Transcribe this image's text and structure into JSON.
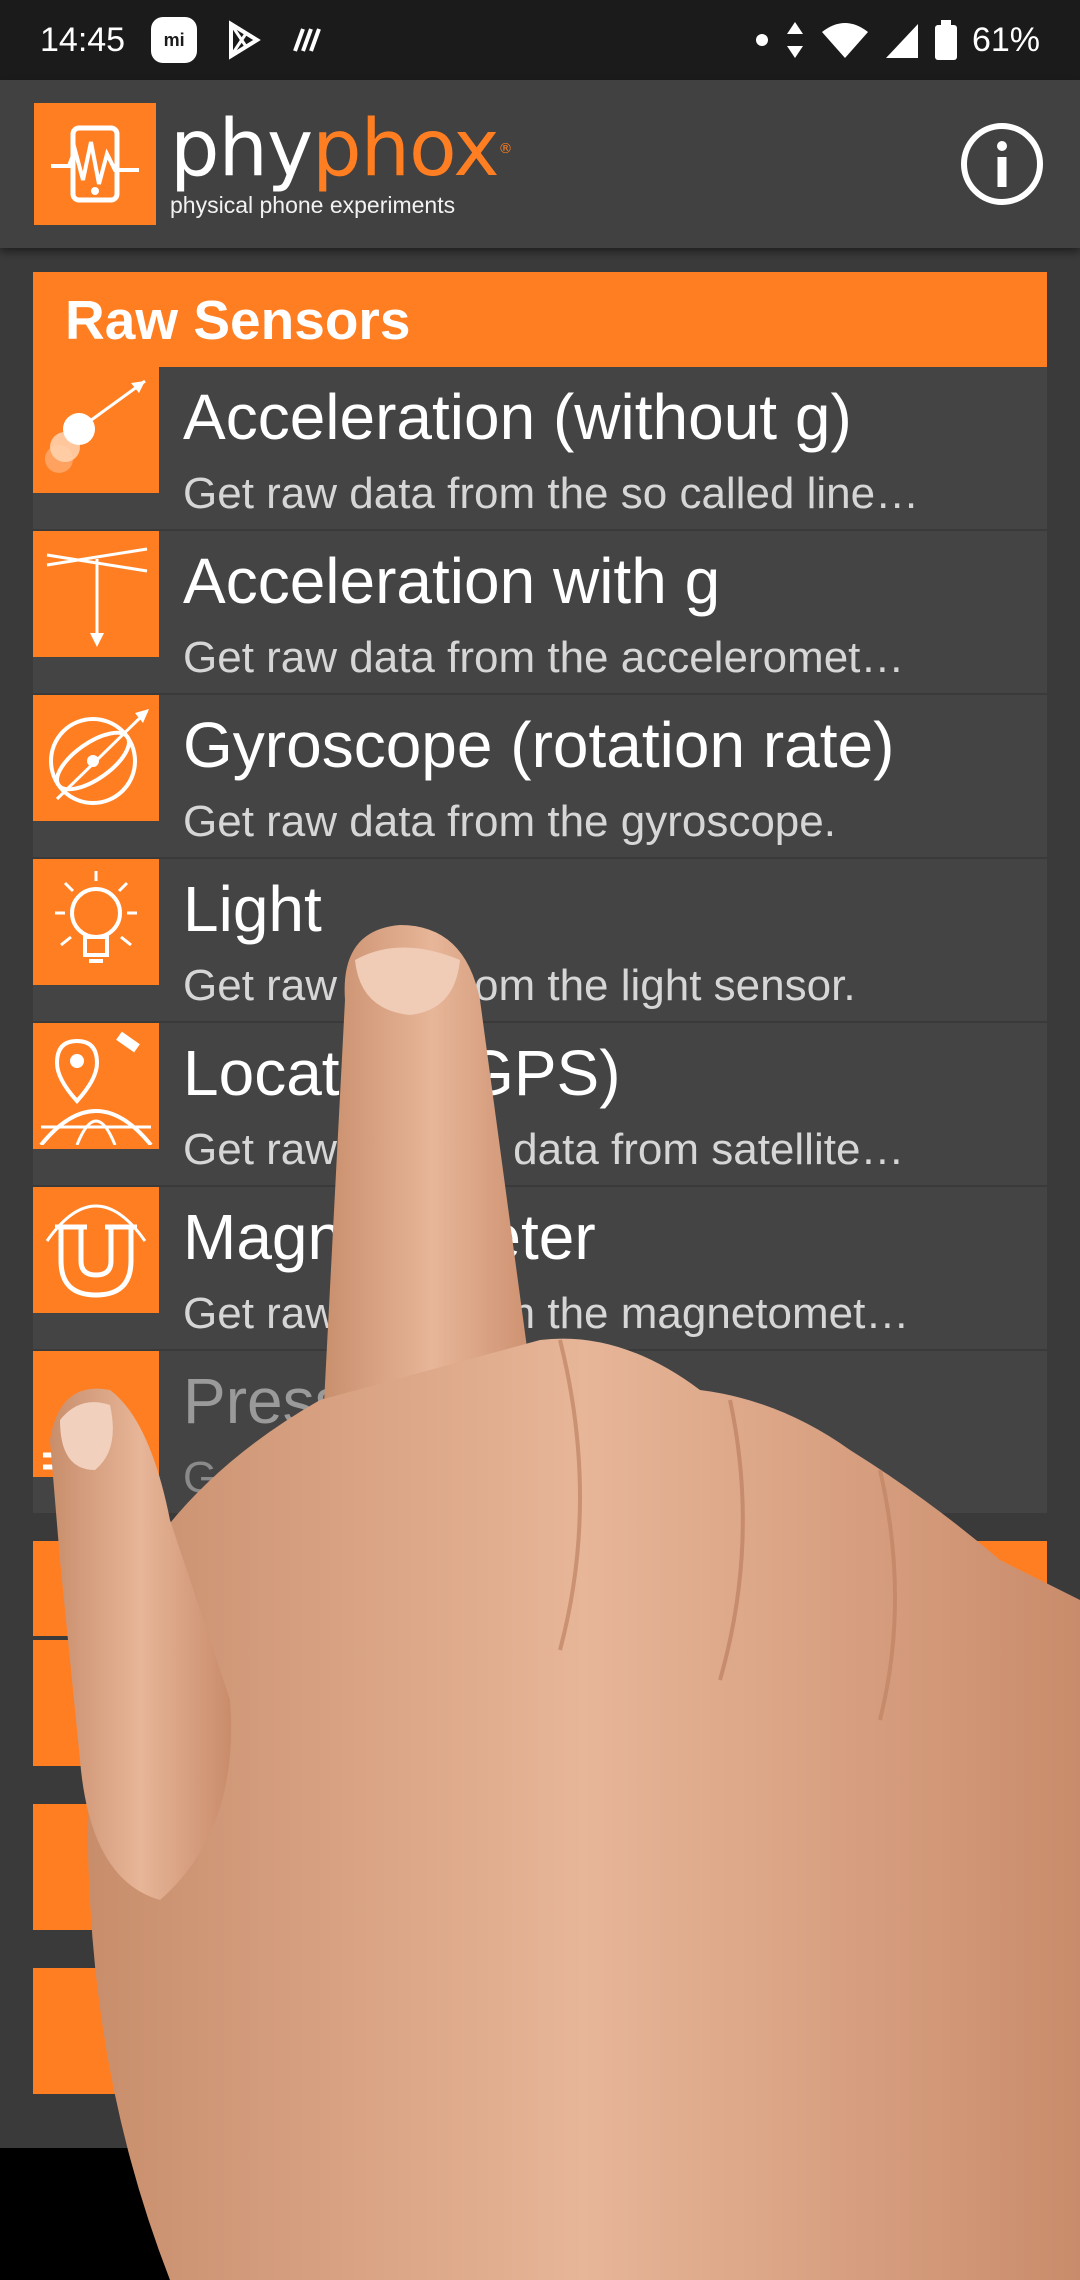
{
  "status_bar": {
    "time": "14:45",
    "battery": "61%",
    "icons": [
      "mi-icon",
      "play-store-icon",
      "notification-icon",
      "dot-icon",
      "data-arrows-icon",
      "wifi-icon",
      "signal-icon",
      "battery-icon"
    ]
  },
  "app_bar": {
    "brand_part1": "phy",
    "brand_part2": "phox",
    "subtitle": "physical phone experiments",
    "info_icon": "info-icon"
  },
  "categories": [
    {
      "title": "Raw Sensors",
      "items": [
        {
          "title": "Acceleration (without g)",
          "desc": "Get raw data from the so called line…",
          "icon": "acceleration-icon"
        },
        {
          "title": "Acceleration with g",
          "desc": "Get raw data from the acceleromet…",
          "icon": "acceleration-g-icon"
        },
        {
          "title": "Gyroscope (rotation rate)",
          "desc": "Get raw data from the gyroscope.",
          "icon": "gyroscope-icon"
        },
        {
          "title": "Light",
          "desc": "Get raw data from the light sensor.",
          "icon": "light-bulb-icon"
        },
        {
          "title": "Location (GPS)",
          "desc": "Get raw location data from satellite…",
          "icon": "location-icon"
        },
        {
          "title": "Magnetometer",
          "desc": "Get raw data from the magnetomet…",
          "icon": "magnet-icon"
        },
        {
          "title": "Pressure",
          "desc": "Get raw data from the barometer.",
          "icon": "pressure-icon"
        }
      ]
    }
  ],
  "colors": {
    "accent": "#ff7e22",
    "background": "#3a3a3a",
    "item_bg": "#444444",
    "app_bar": "#414141",
    "status_bar": "#1b1b1b"
  }
}
